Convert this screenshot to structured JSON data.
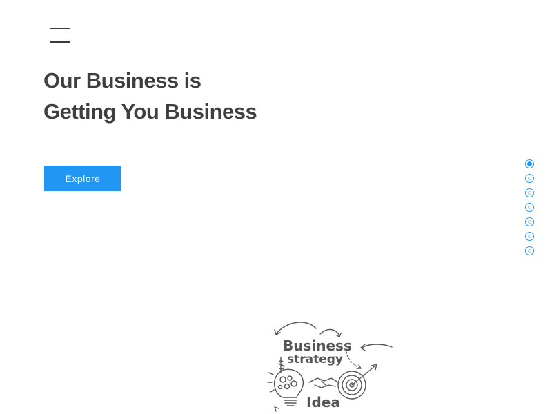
{
  "header": {
    "menu_icon": "hamburger-menu-icon"
  },
  "hero": {
    "title_line1": "Our Business is",
    "title_line2": "Getting You Business",
    "cta_label": "Explore"
  },
  "pager": {
    "count": 7,
    "active_index": 0
  },
  "illustration": {
    "icon": "business-strategy-sketch",
    "line1": "Business",
    "line2": "strategy",
    "line3": "Idea"
  },
  "colors": {
    "accent": "#2196f3",
    "heading": "#3f3f3f",
    "background": "#ffffff"
  }
}
